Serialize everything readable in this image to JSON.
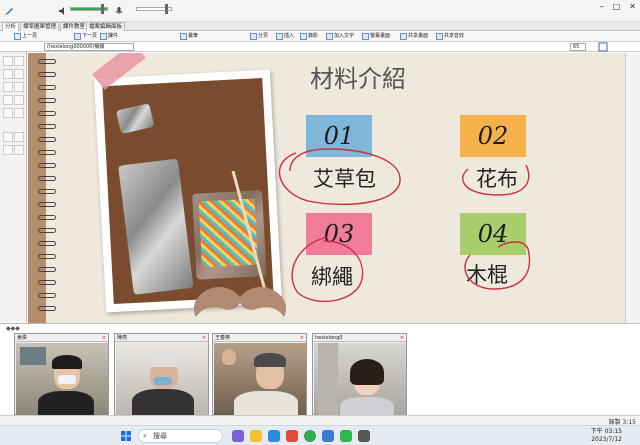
{
  "toolbar": {
    "tabs": [
      "分析",
      "標準圖庫管理",
      "課件教室",
      "檔案編輯面板"
    ],
    "buttons": [
      "上一頁",
      "下一頁",
      "課件",
      "畫筆",
      "分頁",
      "插入",
      "錄影",
      "加入文字",
      "螢幕畫面",
      "共享畫面",
      "共享音效"
    ],
    "doc_name": "(hexielong000000)簡報",
    "zoom_value": "65"
  },
  "slide": {
    "title": "材料介紹",
    "items": [
      {
        "number": "01",
        "label": "艾草包",
        "color": "#7fb6d9"
      },
      {
        "number": "02",
        "label": "花布",
        "color": "#f5b24a"
      },
      {
        "number": "03",
        "label": "綁繩",
        "color": "#f07b9a"
      },
      {
        "number": "04",
        "label": "木棍",
        "color": "#a8cf6c"
      }
    ]
  },
  "gallery": {
    "header": "◆◆◆",
    "participants": [
      {
        "name": "姜柔"
      },
      {
        "name": "陳燕"
      },
      {
        "name": "王春英"
      },
      {
        "name": "hexielong0"
      }
    ]
  },
  "status": {
    "right_text": "錄製 3:15"
  },
  "taskbar": {
    "search_placeholder": "搜尋",
    "time": "下午 03:15",
    "date": "2023/7/12"
  }
}
